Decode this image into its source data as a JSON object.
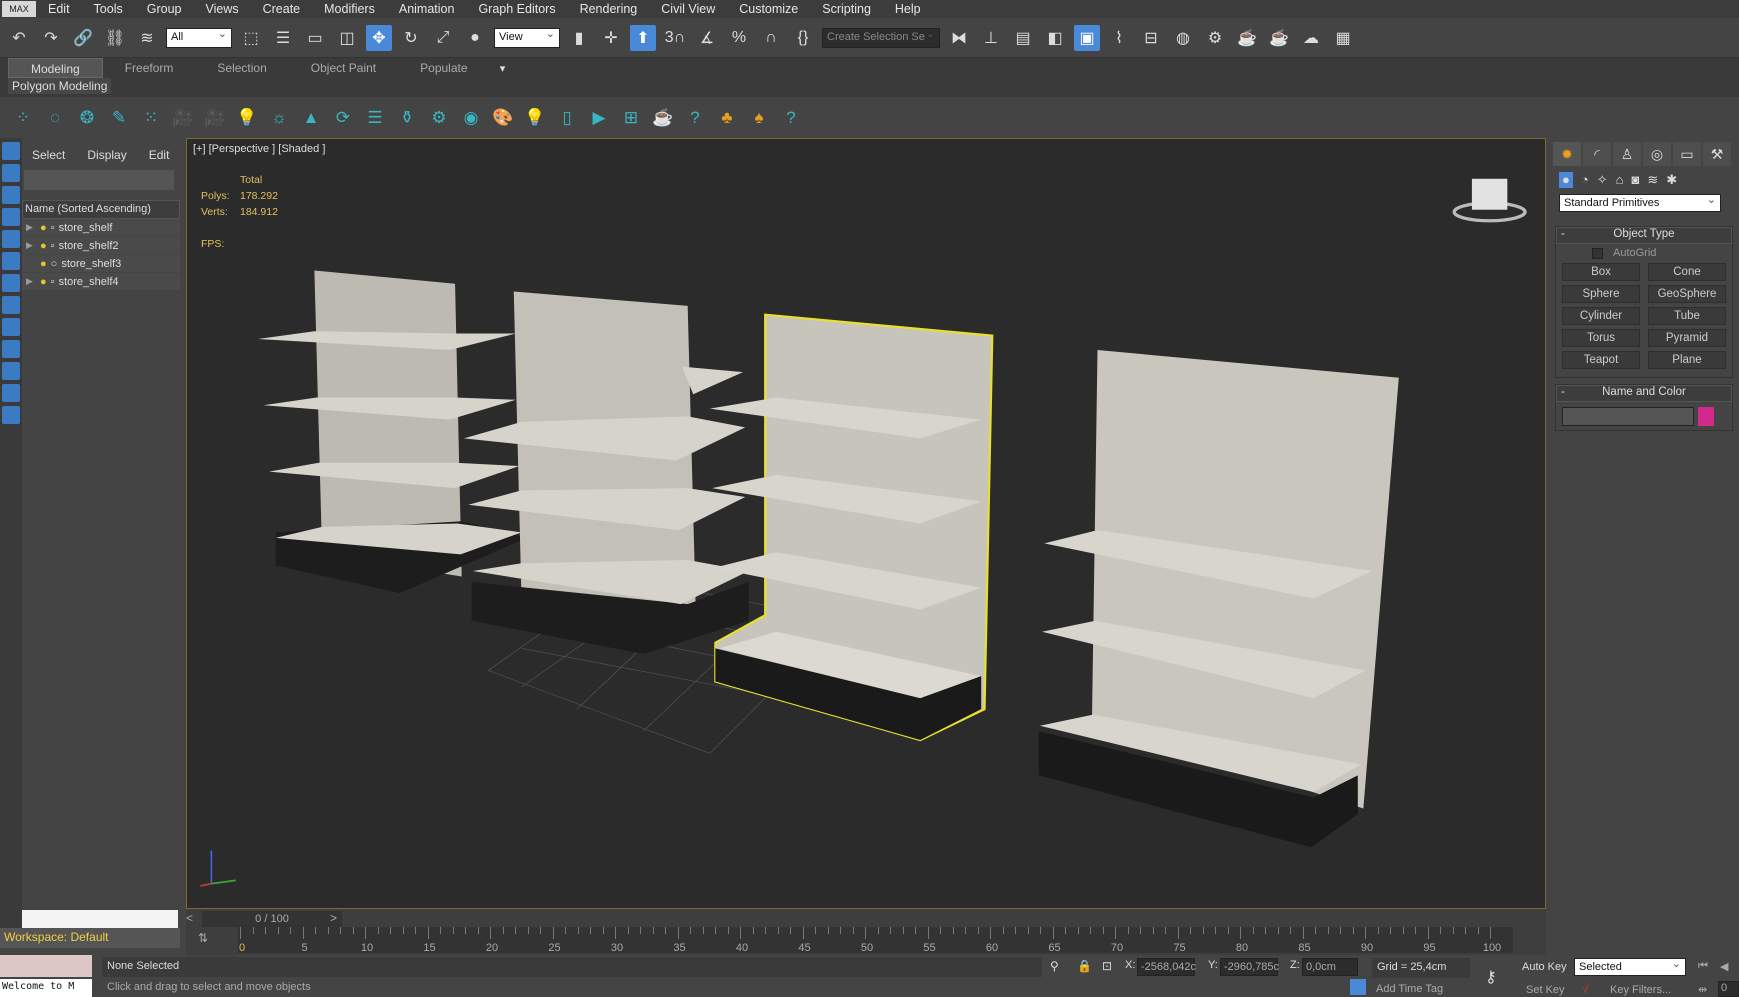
{
  "menu": {
    "logo": "MAX",
    "items": [
      "Edit",
      "Tools",
      "Group",
      "Views",
      "Create",
      "Modifiers",
      "Animation",
      "Graph Editors",
      "Rendering",
      "Civil View",
      "Customize",
      "Scripting",
      "Help"
    ]
  },
  "toolbar": {
    "filter_value": "All",
    "coord_value": "View",
    "selection_set_placeholder": "Create Selection Se"
  },
  "ribbon": {
    "tabs": [
      "Modeling",
      "Freeform",
      "Selection",
      "Object Paint",
      "Populate"
    ],
    "sub_tab": "Polygon Modeling"
  },
  "scene_explorer": {
    "tabs": [
      "Select",
      "Display",
      "Edit"
    ],
    "column_header": "Name (Sorted Ascending)",
    "items": [
      {
        "name": "store_shelf"
      },
      {
        "name": "store_shelf2"
      },
      {
        "name": "store_shelf3"
      },
      {
        "name": "store_shelf4"
      }
    ],
    "workspace": "Workspace: Default"
  },
  "viewport": {
    "label": "[+] [Perspective ] [Shaded ]",
    "stats": {
      "total_label": "Total",
      "polys_label": "Polys:",
      "polys": "178.292",
      "verts_label": "Verts:",
      "verts": "184.912",
      "fps_label": "FPS:"
    }
  },
  "command_panel": {
    "category": "Standard Primitives",
    "object_type_title": "Object Type",
    "autogrid": "AutoGrid",
    "buttons": [
      "Box",
      "Cone",
      "Sphere",
      "GeoSphere",
      "Cylinder",
      "Tube",
      "Torus",
      "Pyramid",
      "Teapot",
      "Plane"
    ],
    "name_color_title": "Name and Color",
    "object_color": "#d12a8a"
  },
  "timeline": {
    "frame": "0 / 100",
    "ticks": [
      "0",
      "5",
      "10",
      "15",
      "20",
      "25",
      "30",
      "35",
      "40",
      "45",
      "50",
      "55",
      "60",
      "65",
      "70",
      "75",
      "80",
      "85",
      "90",
      "95",
      "100"
    ]
  },
  "status": {
    "listener": "Welcome to M",
    "selection": "None Selected",
    "prompt": "Click and drag to select and move objects",
    "x_label": "X:",
    "x": "-2568,042c",
    "y_label": "Y:",
    "y": "-2960,785c",
    "z_label": "Z:",
    "z": "0,0cm",
    "grid": "Grid = 25,4cm",
    "add_time_tag": "Add Time Tag",
    "auto_key": "Auto Key",
    "set_key": "Set Key",
    "key_mode": "Selected",
    "key_filters": "Key Filters...",
    "frame_value": "0"
  }
}
